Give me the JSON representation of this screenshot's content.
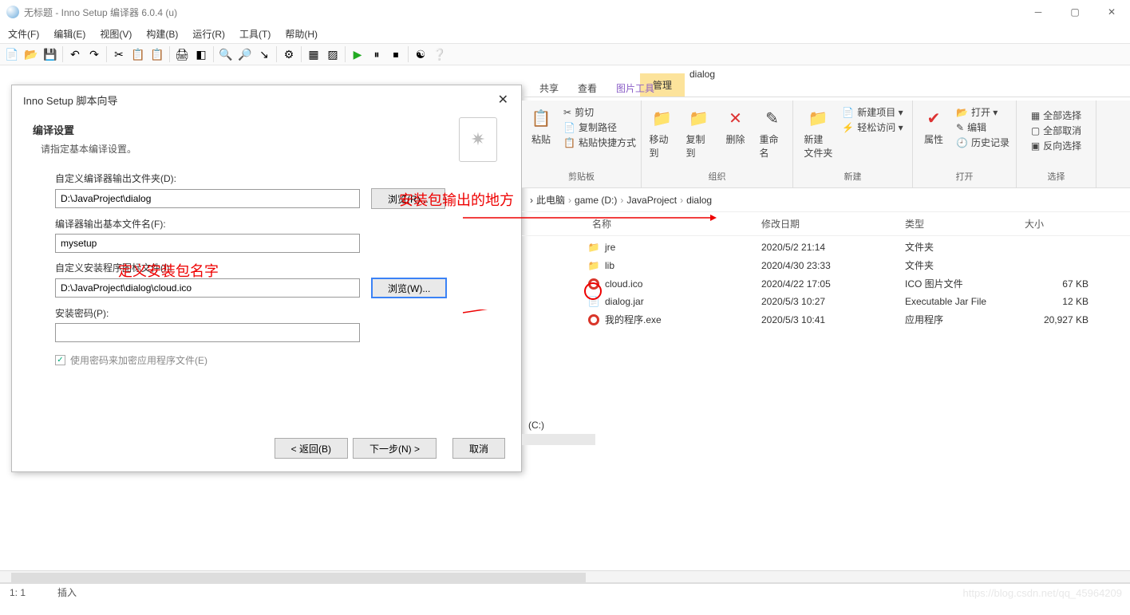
{
  "window": {
    "title": "无标题 - Inno Setup 编译器 6.0.4 (u)"
  },
  "menu": {
    "file": "文件(F)",
    "edit": "编辑(E)",
    "view": "视图(V)",
    "build": "构建(B)",
    "run": "运行(R)",
    "tools": "工具(T)",
    "help": "帮助(H)"
  },
  "wizard": {
    "title": "Inno Setup 脚本向导",
    "heading": "编译设置",
    "subheading": "请指定基本编译设置。",
    "outdir_label": "自定义编译器输出文件夹(D):",
    "outdir_value": "D:\\JavaProject\\dialog",
    "browse_r": "浏览(R)...",
    "basefile_label": "编译器输出基本文件名(F):",
    "basefile_value": "mysetup",
    "iconfile_label": "自定义安装程序图标文件(I):",
    "iconfile_value": "D:\\JavaProject\\dialog\\cloud.ico",
    "browse_w": "浏览(W)...",
    "password_label": "安装密码(P):",
    "encrypt_label": "使用密码来加密应用程序文件(E)",
    "back": "< 返回(B)",
    "next": "下一步(N) >",
    "cancel": "取消"
  },
  "annotations": {
    "a1": "安装包输出的地方",
    "a2": "定义安装包名字"
  },
  "explorer": {
    "manage": "管理",
    "title": "dialog",
    "share": "共享",
    "view_tab": "查看",
    "imgtools": "图片工具",
    "paste": "粘贴",
    "cut": "剪切",
    "copypath": "复制路径",
    "pasteshortcut": "粘贴快捷方式",
    "moveto": "移动到",
    "copyto": "复制到",
    "delete": "删除",
    "rename": "重命名",
    "newfolder": "新建\n文件夹",
    "newitem": "新建项目 ▾",
    "easyaccess": "轻松访问 ▾",
    "properties": "属性",
    "open": "打开 ▾",
    "edit": "编辑",
    "history": "历史记录",
    "selectall": "全部选择",
    "selectnone": "全部取消",
    "invert": "反向选择",
    "grp_clip": "剪贴板",
    "grp_org": "组织",
    "grp_new": "新建",
    "grp_open": "打开",
    "grp_sel": "选择",
    "bc": {
      "pc": "此电脑",
      "drive": "game (D:)",
      "proj": "JavaProject",
      "folder": "dialog"
    },
    "cols": {
      "name": "名称",
      "date": "修改日期",
      "type": "类型",
      "size": "大小"
    },
    "files": [
      {
        "icon": "folder",
        "name": "jre",
        "date": "2020/5/2 21:14",
        "type": "文件夹",
        "size": ""
      },
      {
        "icon": "folder",
        "name": "lib",
        "date": "2020/4/30 23:33",
        "type": "文件夹",
        "size": ""
      },
      {
        "icon": "red",
        "name": "cloud.ico",
        "date": "2020/4/22 17:05",
        "type": "ICO 图片文件",
        "size": "67 KB"
      },
      {
        "icon": "file",
        "name": "dialog.jar",
        "date": "2020/5/3 10:27",
        "type": "Executable Jar File",
        "size": "12 KB"
      },
      {
        "icon": "red",
        "name": "我的程序.exe",
        "date": "2020/5/3 10:41",
        "type": "应用程序",
        "size": "20,927 KB"
      }
    ],
    "drive_c": "(C:)"
  },
  "status": {
    "pos": "1:  1",
    "mode": "插入"
  },
  "watermark": "https://blog.csdn.net/qq_45964209"
}
